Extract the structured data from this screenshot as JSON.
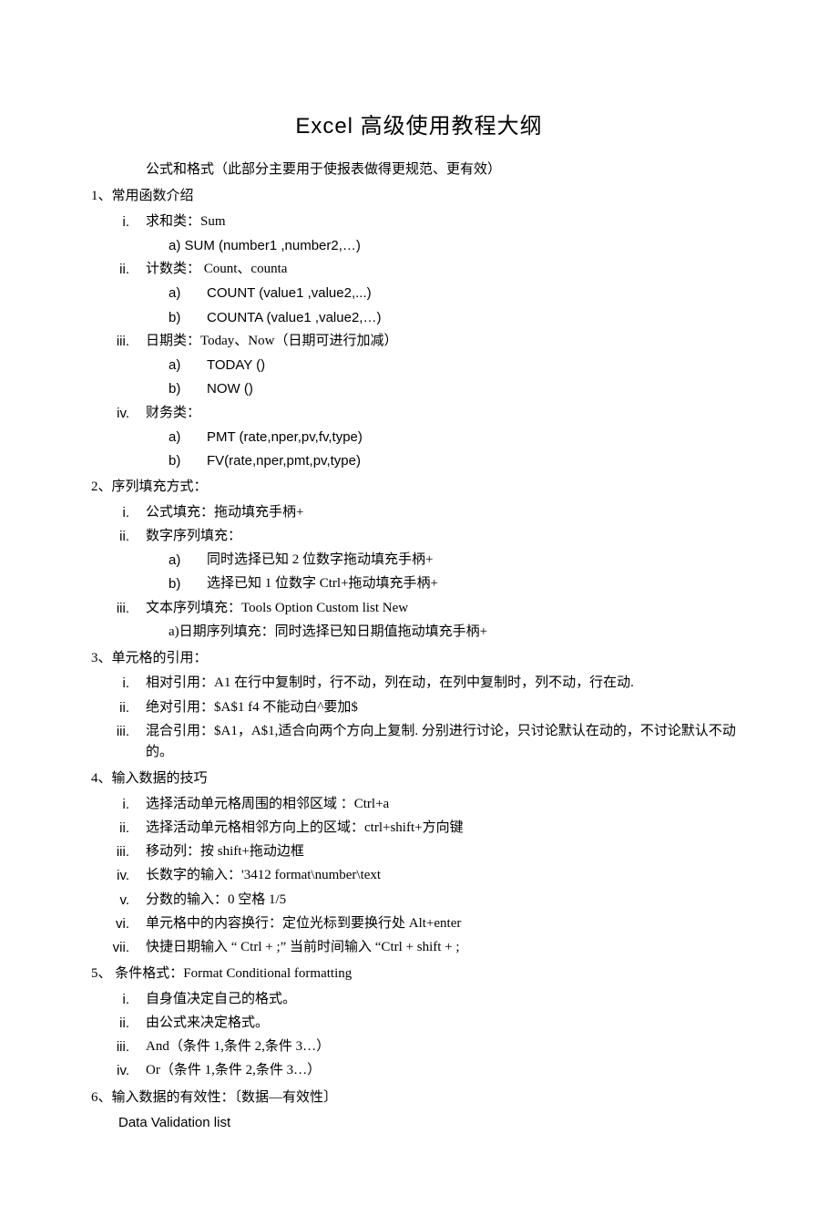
{
  "title": "Excel 高级使用教程大纲",
  "subtitle": "公式和格式（此部分主要用于使报表做得更规范、更有效）",
  "s1": {
    "head": "1、常用函数介绍",
    "i_label": "i.",
    "i_text": "求和类：Sum",
    "i_a": "a) SUM (number1 ,number2,…)",
    "ii_label": "ii.",
    "ii_text": "计数类：  Count、counta",
    "ii_a_lbl": "a)",
    "ii_a": "COUNT (value1 ,value2,...)",
    "ii_b_lbl": "b)",
    "ii_b": "COUNTA (value1 ,value2,…)",
    "iii_label": "iii.",
    "iii_text": "日期类：Today、Now（日期可进行加减）",
    "iii_a_lbl": "a)",
    "iii_a": "TODAY ()",
    "iii_b_lbl": "b)",
    "iii_b": "NOW ()",
    "iv_label": "iv.",
    "iv_text": "财务类：",
    "iv_a_lbl": "a)",
    "iv_a": "PMT (rate,nper,pv,fv,type)",
    "iv_b_lbl": "b)",
    "iv_b": "FV(rate,nper,pmt,pv,type)"
  },
  "s2": {
    "head": "2、序列填充方式：",
    "i_label": "i.",
    "i_text": "公式填充：拖动填充手柄+",
    "ii_label": "ii.",
    "ii_text": "数字序列填充：",
    "ii_a_lbl": "a)",
    "ii_a": "同时选择已知 2 位数字拖动填充手柄+",
    "ii_b_lbl": "b)",
    "ii_b": "选择已知 1 位数字 Ctrl+拖动填充手柄+",
    "iii_label": "iii.",
    "iii_text": "文本序列填充：Tools Option Custom list New",
    "iii_a": "a)日期序列填充：同时选择已知日期值拖动填充手柄+"
  },
  "s3": {
    "head": "3、单元格的引用：",
    "i_label": "i.",
    "i_text": "相对引用：A1 在行中复制时，行不动，列在动，在列中复制时，列不动，行在动.",
    "ii_label": "ii.",
    "ii_text": "绝对引用：$A$1 f4 不能动白^要加$",
    "iii_label": "iii.",
    "iii_text": "混合引用：$A1，A$1,适合向两个方向上复制. 分别进行讨论，只讨论默认在动的，不讨论默认不动的。"
  },
  "s4": {
    "head": "4、输入数据的技巧",
    "i_label": "i.",
    "i_text": "选择活动单元格周围的相邻区域  ：Ctrl+a",
    "ii_label": "ii.",
    "ii_text": "选择活动单元格相邻方向上的区域：ctrl+shift+方向键",
    "iii_label": "iii.",
    "iii_text": "移动列：按 shift+拖动边框",
    "iv_label": "iv.",
    "iv_text": "长数字的输入：'3412 format\\number\\text",
    "v_label": "v.",
    "v_text": "分数的输入：0 空格 1/5",
    "vi_label": "vi.",
    "vi_text": "单元格中的内容换行：定位光标到要换行处 Alt+enter",
    "vii_label": "vii.",
    "vii_text": "快捷日期输入  “  Ctrl + ;” 当前时间输入  “Ctrl + shift + ;"
  },
  "s5": {
    "head": "5、 条件格式：Format Conditional formatting",
    "i_label": "i.",
    "i_text": "自身值决定自己的格式。",
    "ii_label": "ii.",
    "ii_text": "由公式来决定格式。",
    "iii_label": "iii.",
    "iii_text": "And（条件 1,条件 2,条件 3…）",
    "iv_label": "iv.",
    "iv_text": "Or（条件 1,条件 2,条件 3…）"
  },
  "s6": {
    "head": "6、输入数据的有效性：〔数据—有效性〕",
    "line": "Data Validation list"
  }
}
